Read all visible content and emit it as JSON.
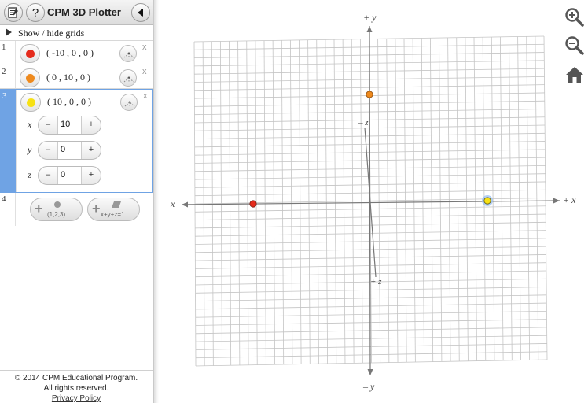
{
  "app": {
    "title": "CPM 3D Plotter"
  },
  "sidebar": {
    "grids_toggle_label": "Show / hide grids",
    "rows": [
      {
        "index": "1",
        "coords": "( -10 , 0 , 0 )",
        "color": "#e52b1c",
        "close": "x"
      },
      {
        "index": "2",
        "coords": "( 0 , 10 , 0 )",
        "color": "#ee8a1e",
        "close": "x"
      },
      {
        "index": "3",
        "coords": "( 10 , 0 , 0 )",
        "color": "#f7e114",
        "close": "x"
      }
    ],
    "steppers": [
      {
        "axis": "x",
        "value": "10",
        "minus": "–",
        "plus": "+"
      },
      {
        "axis": "y",
        "value": "0",
        "minus": "–",
        "plus": "+"
      },
      {
        "axis": "z",
        "value": "0",
        "minus": "–",
        "plus": "+"
      }
    ],
    "add_row_index": "4",
    "add_point_caption": "(1,2,3)",
    "add_plane_caption": "x+y+z=1"
  },
  "footer": {
    "copyright": "© 2014 CPM Educational Program.",
    "rights": "All rights reserved.",
    "privacy": "Privacy Policy"
  },
  "plot": {
    "axis_labels": {
      "pos_y": "+ y",
      "neg_y": "– y",
      "pos_x": "+ x",
      "neg_x": "– x",
      "neg_z": "– z",
      "pos_z": "+ z"
    },
    "points": [
      {
        "x": -10,
        "y": 0,
        "z": 0,
        "color": "#e52b1c"
      },
      {
        "x": 0,
        "y": 10,
        "z": 0,
        "color": "#ee8a1e"
      },
      {
        "x": 10,
        "y": 0,
        "z": 0,
        "color": "#f7e114",
        "selected": true
      }
    ]
  },
  "toolbar": {
    "zoom_in_icon": "zoom-in-icon",
    "zoom_out_icon": "zoom-out-icon",
    "home_icon": "home-icon"
  }
}
